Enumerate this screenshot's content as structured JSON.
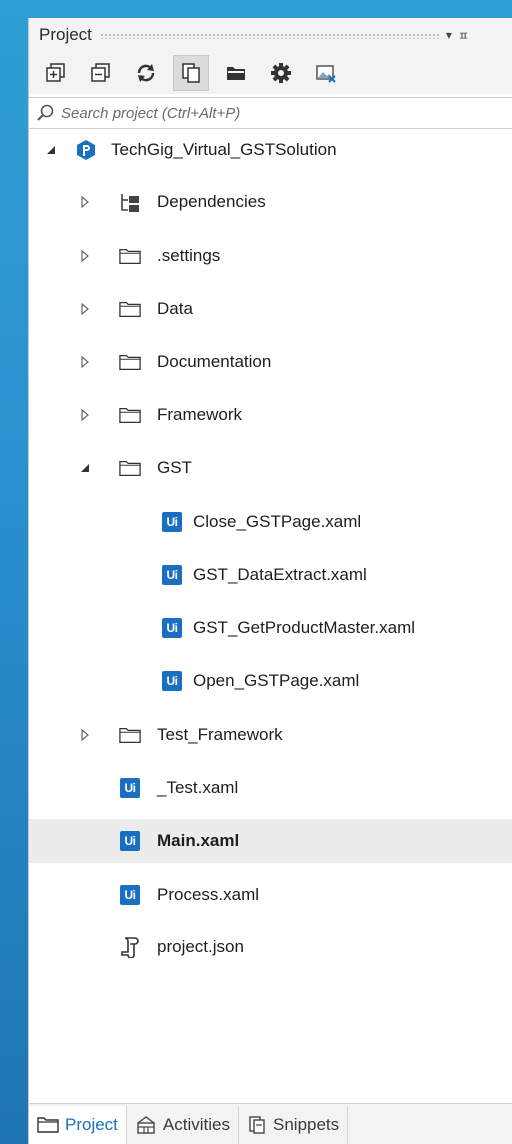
{
  "panel": {
    "title": "Project",
    "header_controls": [
      "▾",
      "ㅍ"
    ]
  },
  "toolbar": {
    "buttons": [
      {
        "name": "expand-all-icon"
      },
      {
        "name": "collapse-all-icon"
      },
      {
        "name": "refresh-icon"
      },
      {
        "name": "copy-files-icon",
        "active": true
      },
      {
        "name": "open-folder-icon"
      },
      {
        "name": "settings-gear-icon"
      },
      {
        "name": "image-remove-icon"
      }
    ]
  },
  "search": {
    "placeholder": "Search project (Ctrl+Alt+P)"
  },
  "tree": {
    "root": "TechGig_Virtual_GSTSolution",
    "items": [
      {
        "label": "Dependencies",
        "icon": "dependencies-icon"
      },
      {
        "label": ".settings",
        "icon": "folder-icon"
      },
      {
        "label": "Data",
        "icon": "folder-icon"
      },
      {
        "label": "Documentation",
        "icon": "folder-icon"
      },
      {
        "label": "Framework",
        "icon": "folder-icon"
      },
      {
        "label": "GST",
        "icon": "folder-icon",
        "expanded": true
      },
      {
        "label": "Close_GSTPage.xaml",
        "icon": "xaml-file-icon"
      },
      {
        "label": "GST_DataExtract.xaml",
        "icon": "xaml-file-icon"
      },
      {
        "label": "GST_GetProductMaster.xaml",
        "icon": "xaml-file-icon"
      },
      {
        "label": "Open_GSTPage.xaml",
        "icon": "xaml-file-icon"
      },
      {
        "label": "Test_Framework",
        "icon": "folder-icon"
      },
      {
        "label": "_Test.xaml",
        "icon": "xaml-file-icon"
      },
      {
        "label": "Main.xaml",
        "icon": "xaml-file-icon",
        "selected": true,
        "bold": true
      },
      {
        "label": "Process.xaml",
        "icon": "xaml-file-icon"
      },
      {
        "label": "project.json",
        "icon": "json-file-icon"
      }
    ],
    "ui_badge": "Ui"
  },
  "tabs": [
    {
      "label": "Project",
      "icon": "folder-icon",
      "active": true
    },
    {
      "label": "Activities",
      "icon": "activities-icon"
    },
    {
      "label": "Snippets",
      "icon": "snippets-icon"
    }
  ],
  "colors": {
    "accent": "#1b6fc2",
    "background": "#2a8fcf",
    "selection": "#ececec"
  }
}
